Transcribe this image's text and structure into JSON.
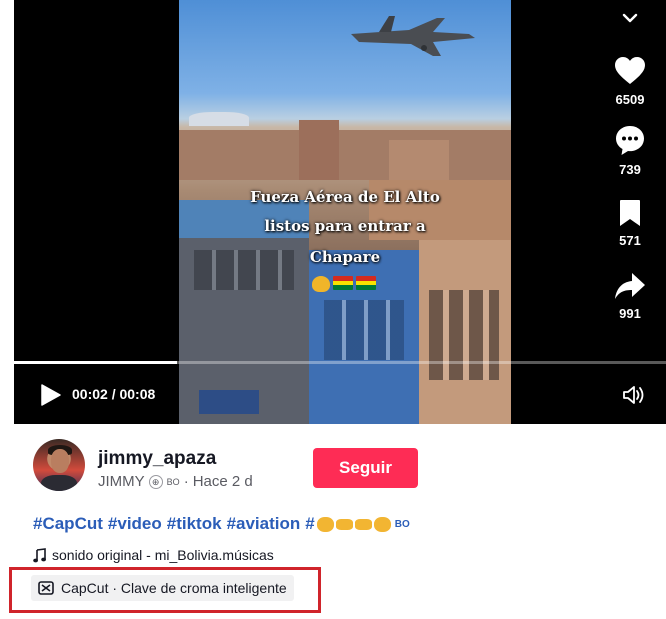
{
  "video": {
    "caption_lines": [
      "Fueza Aérea de El Alto",
      "listos para entrar a",
      "Chapare"
    ],
    "progress": 0.25,
    "time_current": "00:02",
    "time_total": "00:08",
    "time_label": "00:02 / 00:08"
  },
  "actions": {
    "likes": "6509",
    "comments": "739",
    "saves": "571",
    "shares": "991"
  },
  "author": {
    "username": "jimmy_apaza",
    "display_name": "JIMMY",
    "region": "BO",
    "posted": "Hace 2 d",
    "separator": "·"
  },
  "follow_label": "Seguir",
  "description": {
    "hashtags": [
      "#CapCut",
      "#video",
      "#tiktok",
      "#aviation",
      "#"
    ],
    "trailing_region": "BO"
  },
  "music": {
    "label": "sonido original - mi_Bolivia.músicas"
  },
  "capcut": {
    "label": "CapCut · Clave de croma inteligente"
  },
  "colors": {
    "follow": "#fe2c55",
    "hashtag": "#2b5db8",
    "highlight_box": "#d0242b"
  },
  "icons": [
    "chevron-down-icon",
    "heart-icon",
    "comment-icon",
    "bookmark-icon",
    "share-icon",
    "play-icon",
    "volume-icon",
    "music-note-icon",
    "capcut-icon"
  ]
}
